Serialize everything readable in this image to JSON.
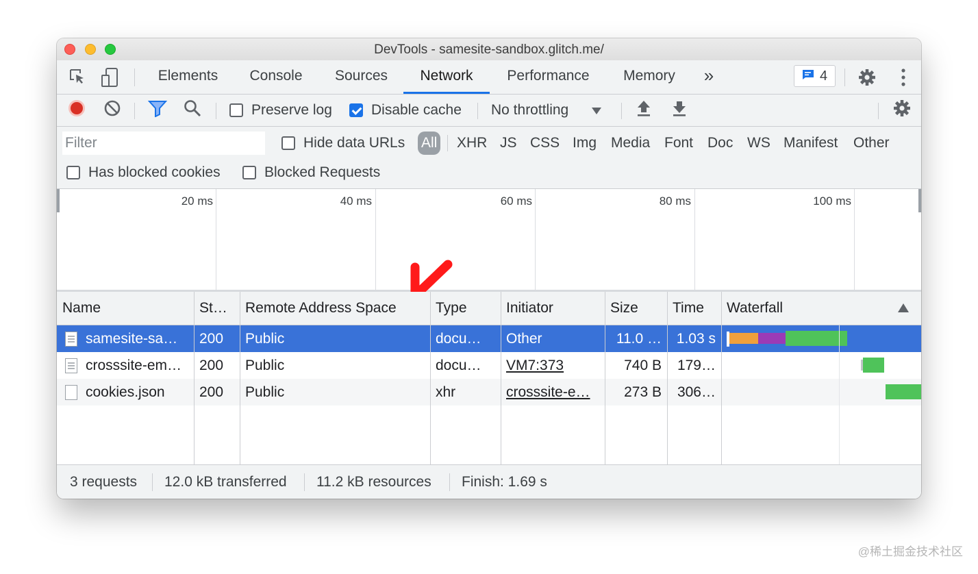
{
  "window": {
    "title": "DevTools - samesite-sandbox.glitch.me/"
  },
  "tabs": [
    {
      "label": "Elements"
    },
    {
      "label": "Console"
    },
    {
      "label": "Sources"
    },
    {
      "label": "Network",
      "active": true
    },
    {
      "label": "Performance"
    },
    {
      "label": "Memory"
    }
  ],
  "more_tabs_label": "»",
  "issues_count": "4",
  "toolbar": {
    "preserve_log": {
      "label": "Preserve log",
      "checked": false
    },
    "disable_cache": {
      "label": "Disable cache",
      "checked": true
    },
    "throttling": "No throttling"
  },
  "filter": {
    "placeholder": "Filter",
    "hide_data_urls": {
      "label": "Hide data URLs",
      "checked": false
    },
    "types": [
      "All",
      "XHR",
      "JS",
      "CSS",
      "Img",
      "Media",
      "Font",
      "Doc",
      "WS",
      "Manifest",
      "Other"
    ],
    "active_type": "All",
    "has_blocked_cookies": {
      "label": "Has blocked cookies",
      "checked": false
    },
    "blocked_requests": {
      "label": "Blocked Requests",
      "checked": false
    }
  },
  "overview": {
    "ticks": [
      "20 ms",
      "40 ms",
      "60 ms",
      "80 ms",
      "100 ms"
    ]
  },
  "table": {
    "columns": [
      "Name",
      "St…",
      "Remote Address Space",
      "Type",
      "Initiator",
      "Size",
      "Time",
      "Waterfall"
    ],
    "rows": [
      {
        "name": "samesite-sa…",
        "status": "200",
        "space": "Public",
        "type": "docu…",
        "initiator": "Other",
        "initiator_link": false,
        "size": "11.0 …",
        "time": "1.03 s",
        "icon": "document-icon",
        "selected": true
      },
      {
        "name": "crosssite-em…",
        "status": "200",
        "space": "Public",
        "type": "docu…",
        "initiator": "VM7:373",
        "initiator_link": true,
        "size": "740 B",
        "time": "179…",
        "icon": "document-icon",
        "selected": false
      },
      {
        "name": "cookies.json",
        "status": "200",
        "space": "Public",
        "type": "xhr",
        "initiator": "crosssite-e…",
        "initiator_link": true,
        "size": "273 B",
        "time": "306…",
        "icon": "file-icon",
        "selected": false
      }
    ]
  },
  "status": {
    "requests": "3 requests",
    "transferred": "12.0 kB transferred",
    "resources": "11.2 kB resources",
    "finish": "Finish: 1.69 s"
  },
  "watermark": "@稀土掘金技术社区",
  "colors": {
    "accent": "#1a73e8",
    "selected_row": "#3972d8",
    "record": "#d93025",
    "annotation_arrow": "#ff1a1a",
    "waterfall_waiting": "#f0a03c",
    "waterfall_ssl": "#9b3bb6",
    "waterfall_download": "#4fc35a"
  }
}
